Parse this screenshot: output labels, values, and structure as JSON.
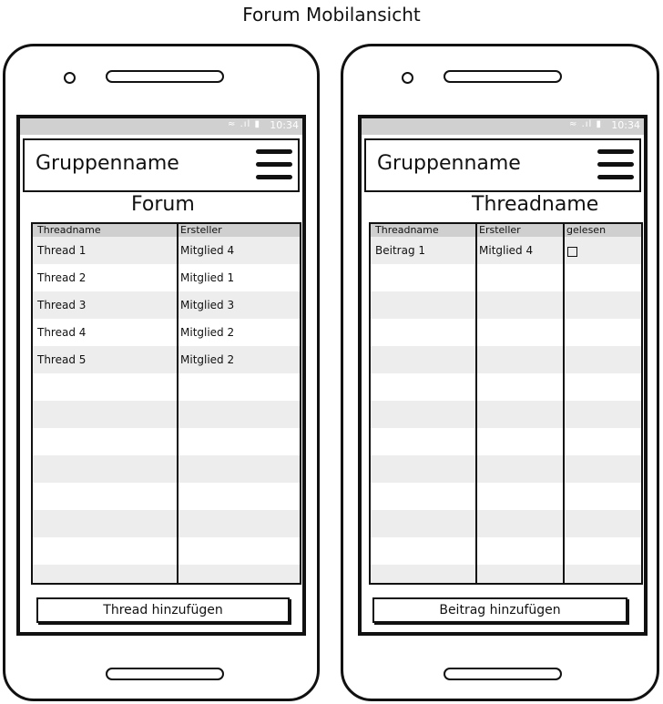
{
  "page_title": "Forum Mobilansicht",
  "colors": {
    "outline": "#111111",
    "status_bar": "#d0d0d0",
    "table_header": "#cfcfcf",
    "row_alt": "#ededed"
  },
  "left_screen": {
    "status_time": "10:34",
    "group_name": "Gruppenname",
    "menu_icon": "hamburger-menu-icon",
    "title": "Forum",
    "columns": [
      "Threadname",
      "Ersteller"
    ],
    "rows": [
      {
        "threadname": "Thread 1",
        "ersteller": "Mitglied 4"
      },
      {
        "threadname": "Thread 2",
        "ersteller": "Mitglied 1"
      },
      {
        "threadname": "Thread 3",
        "ersteller": "Mitglied 3"
      },
      {
        "threadname": "Thread 4",
        "ersteller": "Mitglied 2"
      },
      {
        "threadname": "Thread 5",
        "ersteller": "Mitglied 2"
      }
    ],
    "add_button": "Thread hinzufügen"
  },
  "right_screen": {
    "status_time": "10:34",
    "group_name": "Gruppenname",
    "menu_icon": "hamburger-menu-icon",
    "title": "Threadname",
    "columns": [
      "Threadname",
      "Ersteller",
      "gelesen"
    ],
    "rows": [
      {
        "threadname": "Beitrag 1",
        "ersteller": "Mitglied 4",
        "gelesen": false
      }
    ],
    "add_button": "Beitrag hinzufügen"
  }
}
